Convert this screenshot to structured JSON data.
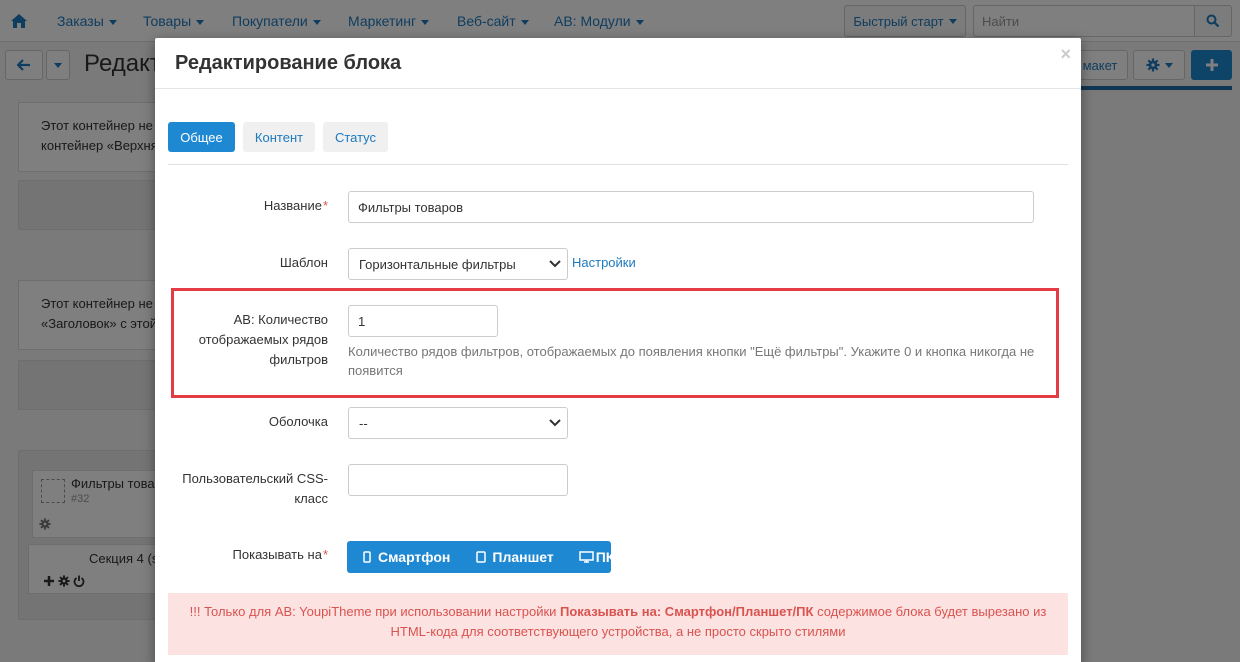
{
  "topnav": {
    "items": [
      "Заказы",
      "Товары",
      "Покупатели",
      "Маркетинг",
      "Веб-сайт",
      "AB: Модули"
    ],
    "quick_start": "Быстрый старт",
    "search_placeholder": "Найти"
  },
  "toolbar": {
    "page_title": "Редакт",
    "layout_button": "макет"
  },
  "background": {
    "container1_line1": "Этот контейнер не",
    "container1_line2": "контейнер «Верхня",
    "container2_line1": "Этот контейнер не",
    "container2_line2": "«Заголовок» с этой",
    "block_name": "Фильтры това",
    "block_id": "#32",
    "section_label": "Секция 4 (s"
  },
  "modal": {
    "title": "Редактирование блока",
    "close": "×",
    "tabs": [
      "Общее",
      "Контент",
      "Статус"
    ],
    "active_tab": "Общее",
    "fields": {
      "name_label": "Название",
      "name_value": "Фильтры товаров",
      "template_label": "Шаблон",
      "template_value": "Горизонтальные фильтры",
      "template_settings_link": "Настройки",
      "ab_rows_label_line1": "AB: Количество",
      "ab_rows_label_line2": "отображаемых рядов",
      "ab_rows_label_line3": "фильтров",
      "ab_rows_value": "1",
      "ab_rows_help_line1": "Количество рядов фильтров, отображаемых до появления кнопки \"Ещё фильтры\". Укажите 0 и кнопка никогда не",
      "ab_rows_help_line2": "появится",
      "wrapper_label": "Оболочка",
      "wrapper_value": "--",
      "css_label_line1": "Пользовательский CSS-",
      "css_label_line2": "класс",
      "css_value": "",
      "show_on_label": "Показывать на"
    },
    "show_on_buttons": [
      "Смартфон",
      "Планшет",
      "ПК"
    ],
    "alert": {
      "prefix": "!!! Только для AB: YoupiTheme при использовании настройки ",
      "bold": "Показывать на: Смартфон/Планшет/ПК",
      "suffix": " содержимое блока будет вырезано из",
      "line2": "HTML-кода для соответствующего устройства, а не просто скрыто стилями"
    }
  },
  "colors": {
    "primary": "#1e88d2",
    "link": "#1e7abf",
    "highlight_border": "#e43c44",
    "alert_bg": "#fde2e2",
    "alert_text": "#d9534f"
  }
}
